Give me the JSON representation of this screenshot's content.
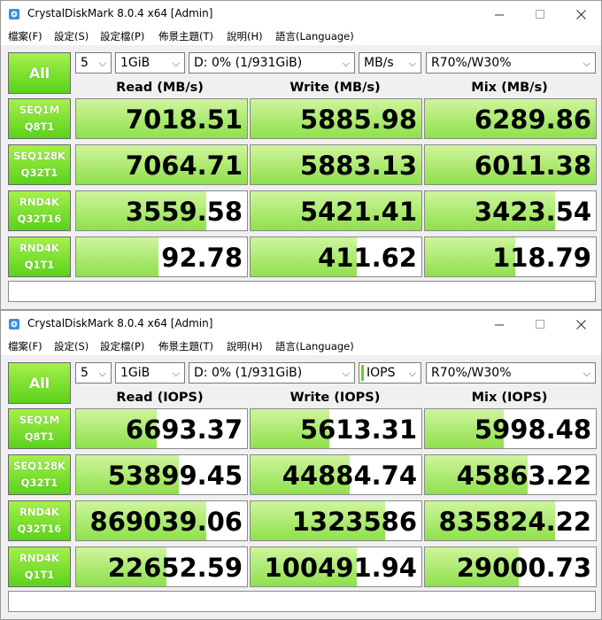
{
  "windows": [
    {
      "title": "CrystalDiskMark 8.0.4 x64 [Admin]",
      "menu": [
        "檔案(F)",
        "設定(S)",
        "設定檔(P)",
        "佈景主題(T)",
        "說明(H)",
        "語言(Language)"
      ],
      "all_label": "All",
      "count": "5",
      "size": "1GiB",
      "drive": "D: 0% (1/931GiB)",
      "unit": "MB/s",
      "unit_accent": false,
      "mix": "R70%/W30%",
      "headers": {
        "read": "Read (MB/s)",
        "write": "Write (MB/s)",
        "mix": "Mix (MB/s)"
      },
      "rows": [
        {
          "label1": "SEQ1M",
          "label2": "Q8T1",
          "read": "7018.51",
          "write": "5885.98",
          "mixv": "6289.86",
          "read_fill": 1.0,
          "write_fill": 1.0,
          "mix_fill": 1.0
        },
        {
          "label1": "SEQ128K",
          "label2": "Q32T1",
          "read": "7064.71",
          "write": "5883.13",
          "mixv": "6011.38",
          "read_fill": 1.0,
          "write_fill": 1.0,
          "mix_fill": 1.0
        },
        {
          "label1": "RND4K",
          "label2": "Q32T16",
          "read": "3559.58",
          "write": "5421.41",
          "mixv": "3423.54",
          "read_fill": 0.76,
          "write_fill": 1.0,
          "mix_fill": 0.76
        },
        {
          "label1": "RND4K",
          "label2": "Q1T1",
          "read": "92.78",
          "write": "411.62",
          "mixv": "118.79",
          "read_fill": 0.48,
          "write_fill": 0.62,
          "mix_fill": 0.53
        }
      ],
      "comment": ""
    },
    {
      "title": "CrystalDiskMark 8.0.4 x64 [Admin]",
      "menu": [
        "檔案(F)",
        "設定(S)",
        "設定檔(P)",
        "佈景主題(T)",
        "說明(H)",
        "語言(Language)"
      ],
      "all_label": "All",
      "count": "5",
      "size": "1GiB",
      "drive": "D: 0% (1/931GiB)",
      "unit": "IOPS",
      "unit_accent": true,
      "mix": "R70%/W30%",
      "headers": {
        "read": "Read (IOPS)",
        "write": "Write (IOPS)",
        "mix": "Mix (IOPS)"
      },
      "rows": [
        {
          "label1": "SEQ1M",
          "label2": "Q8T1",
          "read": "6693.37",
          "write": "5613.31",
          "mixv": "5998.48",
          "read_fill": 0.47,
          "write_fill": 0.46,
          "mix_fill": 0.46
        },
        {
          "label1": "SEQ128K",
          "label2": "Q32T1",
          "read": "53899.45",
          "write": "44884.74",
          "mixv": "45863.22",
          "read_fill": 0.6,
          "write_fill": 0.58,
          "mix_fill": 0.6
        },
        {
          "label1": "RND4K",
          "label2": "Q32T16",
          "read": "869039.06",
          "write": "1323586",
          "mixv": "835824.22",
          "read_fill": 0.76,
          "write_fill": 0.79,
          "mix_fill": 0.76
        },
        {
          "label1": "RND4K",
          "label2": "Q1T1",
          "read": "22652.59",
          "write": "100491.94",
          "mixv": "29000.73",
          "read_fill": 0.53,
          "write_fill": 0.62,
          "mix_fill": 0.55
        }
      ],
      "comment": ""
    }
  ],
  "colors": {
    "accent_green": "#5ad21a",
    "fill_green": "#8fe04b"
  }
}
